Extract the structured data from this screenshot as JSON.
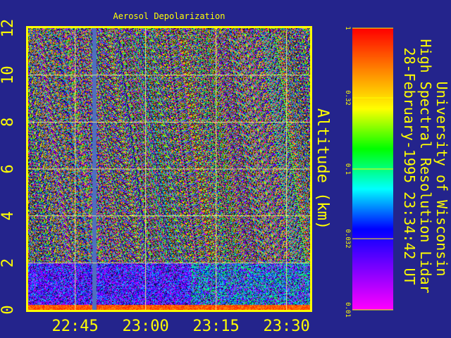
{
  "chart_data": {
    "type": "heatmap",
    "title": "Aerosol Depolarization",
    "ylabel": "Altitude (km)",
    "xlabel": "",
    "x_ticks": [
      "22:45",
      "23:00",
      "23:15",
      "23:30"
    ],
    "y_ticks": [
      "0",
      "2",
      "4",
      "6",
      "8",
      "10",
      "12"
    ],
    "ylim": [
      0,
      12
    ],
    "xlim": [
      "22:35",
      "23:35"
    ],
    "grid": true,
    "colorbar": {
      "scale": "log",
      "ticks": [
        "1",
        "0.32",
        "0.1",
        "0.032",
        "0.01"
      ],
      "range": [
        0.01,
        1
      ],
      "colormap": [
        "#ff00ff",
        "#8000ff",
        "#0000ff",
        "#00ffff",
        "#00ff00",
        "#ffff00",
        "#ff8000",
        "#ff0000"
      ]
    },
    "features": {
      "boundary_layer_top_km": 2.0,
      "data_gap_time": "22:49",
      "surface_layer_km": 0.2
    }
  },
  "caption": {
    "line1": "University of Wisconsin",
    "line2": "High Spectral Resolution Lidar",
    "line3": "28-February-1995 23:34:42 UT"
  },
  "colors": {
    "background": "#24248c",
    "frame": "#ffff00",
    "text": "#ffff00"
  }
}
